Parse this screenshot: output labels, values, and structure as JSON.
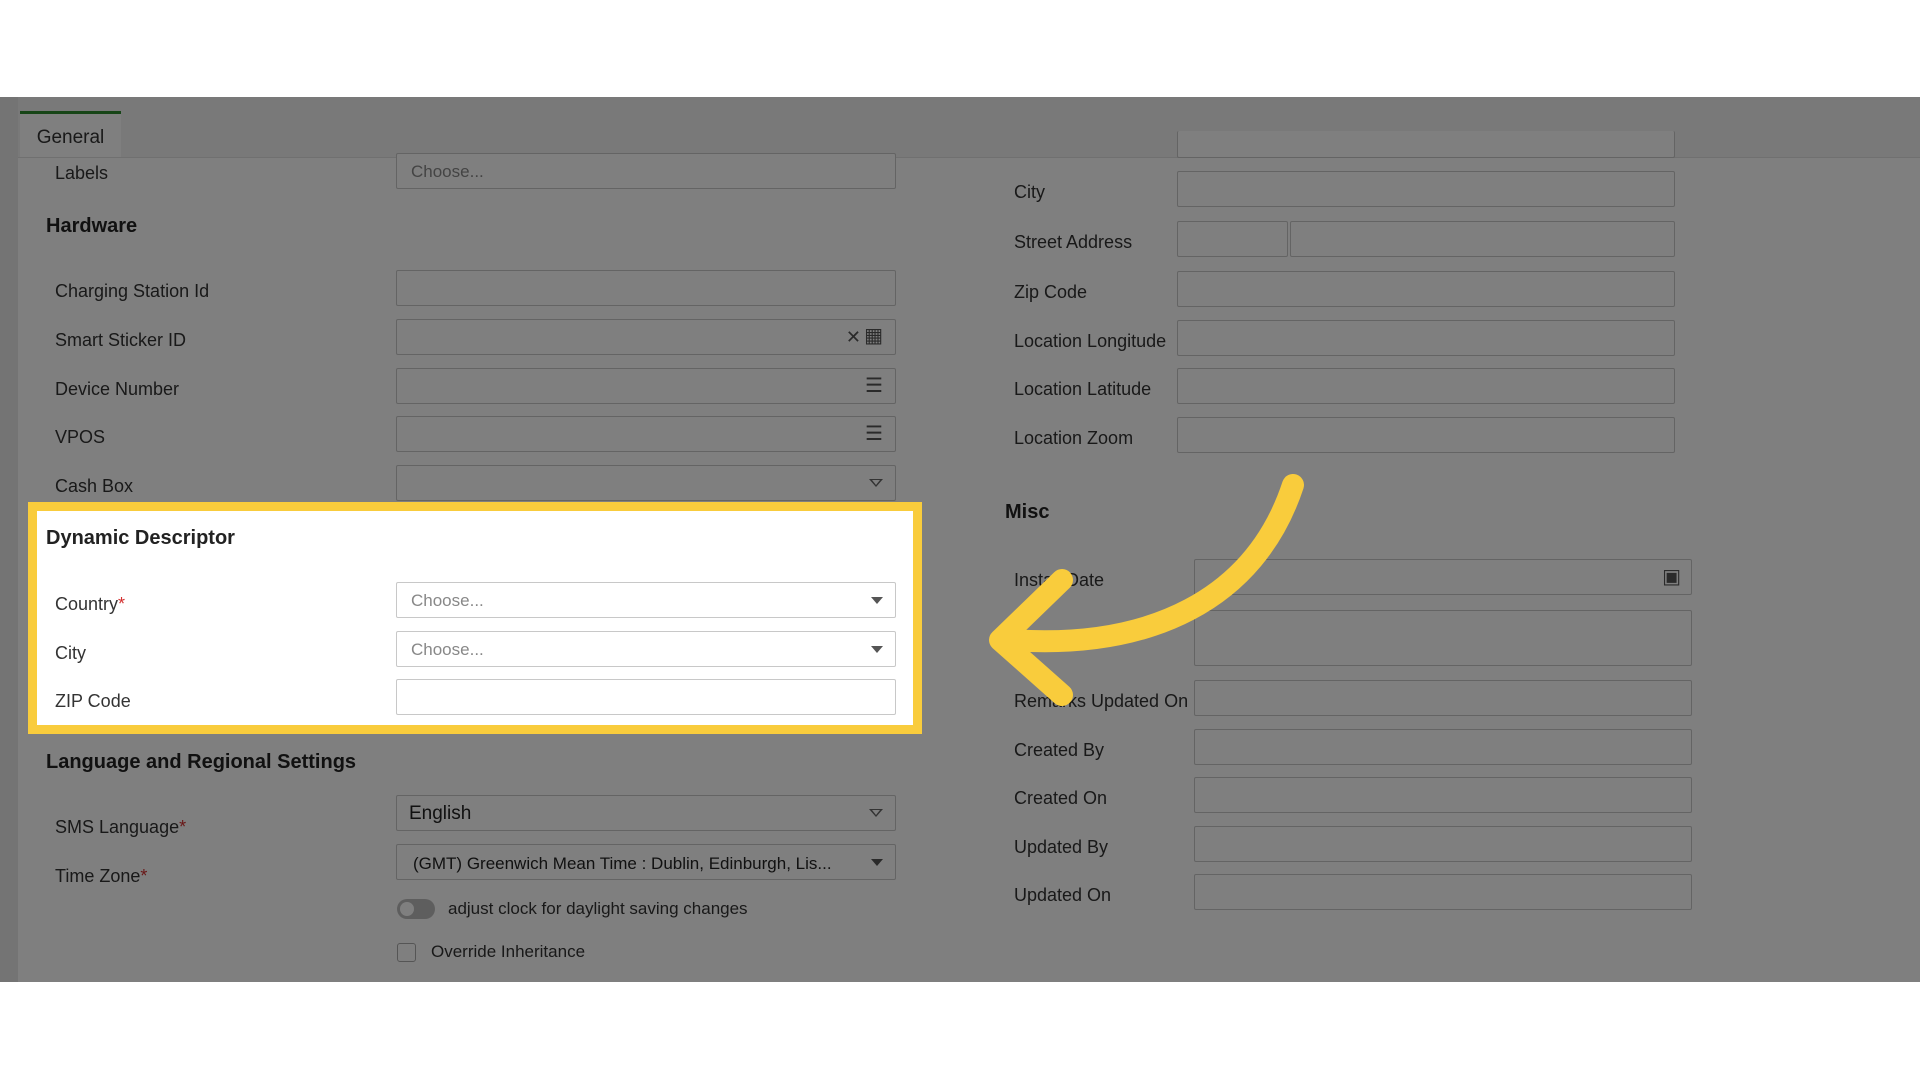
{
  "tabs": [
    {
      "label": "General"
    }
  ],
  "left": {
    "labels_field": {
      "label": "Labels",
      "placeholder": "Choose..."
    },
    "hardware": {
      "title": "Hardware",
      "charging_station_id": "Charging Station Id",
      "smart_sticker_id": "Smart Sticker ID",
      "device_number": "Device Number",
      "vpos": "VPOS",
      "cash_box": "Cash Box"
    },
    "dynamic_descriptor": {
      "title": "Dynamic Descriptor",
      "country": {
        "label": "Country",
        "required": "*",
        "placeholder": "Choose..."
      },
      "city": {
        "label": "City",
        "placeholder": "Choose..."
      },
      "zip": {
        "label": "ZIP Code",
        "value": ""
      }
    },
    "language": {
      "title": "Language and Regional Settings",
      "sms_language": {
        "label": "SMS Language",
        "required": "*",
        "value": "English"
      },
      "time_zone": {
        "label": "Time Zone",
        "required": "*",
        "value": "(GMT) Greenwich Mean Time : Dublin, Edinburgh, Lis..."
      },
      "dst_toggle": "adjust clock for daylight saving changes",
      "override": "Override Inheritance"
    }
  },
  "right": {
    "city": "City",
    "street_address": "Street Address",
    "zip_code": "Zip Code",
    "longitude": "Location Longitude",
    "latitude": "Location Latitude",
    "zoom": "Location Zoom",
    "misc": {
      "title": "Misc",
      "install_date": "Install Date",
      "remarks_updated_on": "Remarks Updated On",
      "created_by": "Created By",
      "created_on": "Created On",
      "updated_by": "Updated By",
      "updated_on": "Updated On"
    }
  },
  "icons": {
    "clear": "close-icon",
    "qr": "qr-code-icon",
    "list": "list-icon",
    "calendar": "calendar-icon",
    "dropdown": "chevron-down-icon"
  },
  "colors": {
    "highlight": "#f9cc3c",
    "tab_accent": "#2e8b2e",
    "required": "#d32f2f"
  }
}
